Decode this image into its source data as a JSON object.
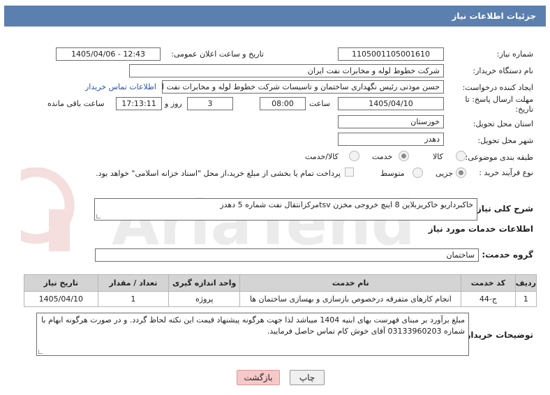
{
  "header": {
    "title": "جزئیات اطلاعات نیاز"
  },
  "fields": {
    "need_number_label": "شماره نیاز:",
    "need_number": "1105001105001610",
    "announce_label": "تاریخ و ساعت اعلان عمومی:",
    "announce_value": "1405/04/06 - 12:43",
    "buyer_org_label": "نام دستگاه خریدار:",
    "buyer_org": "شرکت خطوط لوله و مخابرات نفت ایران",
    "requester_label": "ایجاد کننده درخواست:",
    "requester": "حسن  موذنی  رئیس نگهداری ساختمان و تاسیسات  شرکت خطوط لوله و مخابرات نفت ایران",
    "contact_link": "اطلاعات تماس خریدار",
    "deadline_label_1": "مهلت ارسال پاسخ: تا",
    "deadline_label_2": "تاریخ:",
    "deadline_date": "1405/04/10",
    "time_label": "ساعت",
    "deadline_time": "08:00",
    "days_value": "3",
    "days_label": "روز و",
    "remaining_time": "17:13:11",
    "remaining_label": "ساعت باقی مانده",
    "province_label": "استان محل تحویل:",
    "province": "خوزستان",
    "city_label": "شهر محل تحویل:",
    "city": "دهدز",
    "category_label": "طبقه بندی موضوعی:",
    "category_options": [
      "کالا",
      "خدمت",
      "کالا/خدمت"
    ],
    "category_selected": 1,
    "process_label": "نوع فرآیند خرید :",
    "process_options": [
      "جزیی",
      "متوسط"
    ],
    "process_selected": 0,
    "payment_note": "پرداخت تمام یا بخشی از مبلغ خرید،از محل \"اسناد خزانه اسلامی\" خواهد بود."
  },
  "description": {
    "label": "شرح کلی نیاز:",
    "text": "خاکبرداریو خاکریزبلاین 8 اینچ خروجی مخزن tsvمرکزانتقال نفت شماره 5 دهدز"
  },
  "services": {
    "section_title": "اطلاعات خدمات مورد نیاز",
    "group_label": "گروه خدمت:",
    "group_value": "ساختمان",
    "columns": [
      "ردیف",
      "کد خدمت",
      "نام خدمت",
      "واحد اندازه گیری",
      "تعداد / مقدار",
      "تاریخ نیاز"
    ],
    "rows": [
      [
        "1",
        "ج-44",
        "انجام کارهای متفرقه درخصوص بازسازی و بهسازی ساختمان ها",
        "پروژه",
        "1",
        "1405/04/10"
      ]
    ]
  },
  "buyer_notes": {
    "label": "توضیحات خریدار:",
    "text": "مبلغ برآورد بر مبنای فهرست بهای ابنیه 1404 میباشد لذا جهت هرگونه پیشنهاد قیمت این نکته لحاظ گردد. و در صورت هرگونه ابهام با شماره 03133960203 آقای خوش کام تماس حاصل فرمایید."
  },
  "buttons": {
    "print": "چاپ",
    "back": "بازگشت"
  },
  "watermark": {
    "text": "AriaTender.neT"
  }
}
